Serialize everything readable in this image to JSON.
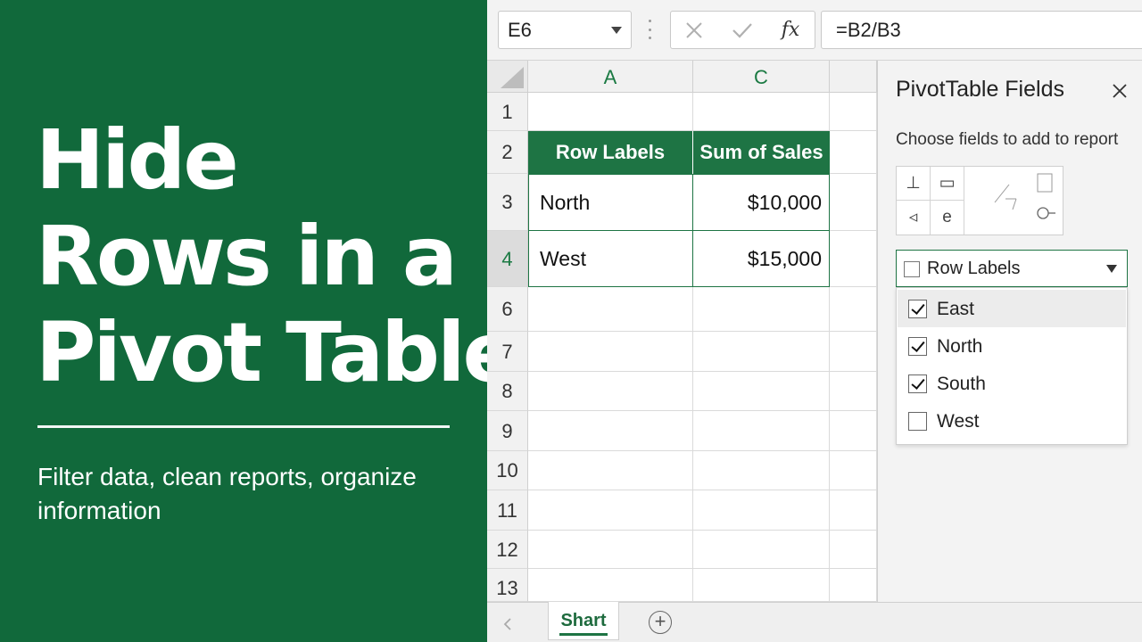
{
  "hero": {
    "title_lines": [
      "Hide",
      "Rows in a",
      "Pivot Table"
    ],
    "subtitle": "Filter data, clean reports, organize information",
    "background_color": "#11693b"
  },
  "formula_bar": {
    "name_box": "E6",
    "cancel_icon": "x-icon",
    "enter_icon": "check-icon",
    "function_label": "fx",
    "formula": "=B2/B3"
  },
  "grid": {
    "columns": [
      "A",
      "C"
    ],
    "rows": [
      "1",
      "2",
      "3",
      "4",
      "6",
      "7",
      "8",
      "9",
      "10",
      "11",
      "12",
      "13"
    ],
    "selected_row": "4",
    "pivot": {
      "headers": [
        "Row Labels",
        "Sum of Sales"
      ],
      "rows": [
        {
          "label": "North",
          "value": "$10,000"
        },
        {
          "label": "West",
          "value": "$15,000"
        }
      ],
      "accent_color": "#1e7444"
    }
  },
  "sheet_tabs": {
    "active": "Shart",
    "add_icon": "plus-circle-icon"
  },
  "pivot_panel": {
    "title": "PivotTable Fields",
    "subtitle": "Choose fields to add to report",
    "layout_icons": [
      "column-layout-icon",
      "table-layout-icon",
      "arrow-left-icon",
      "e-icon",
      "chart-layout-icon"
    ],
    "layout_glyphs": [
      "⊥",
      "▭",
      "◃",
      "e"
    ],
    "dropdown": {
      "label": "Row Labels",
      "items": [
        {
          "label": "East",
          "checked": true
        },
        {
          "label": "North",
          "checked": true
        },
        {
          "label": "South",
          "checked": true
        },
        {
          "label": "West",
          "checked": false
        }
      ]
    }
  }
}
